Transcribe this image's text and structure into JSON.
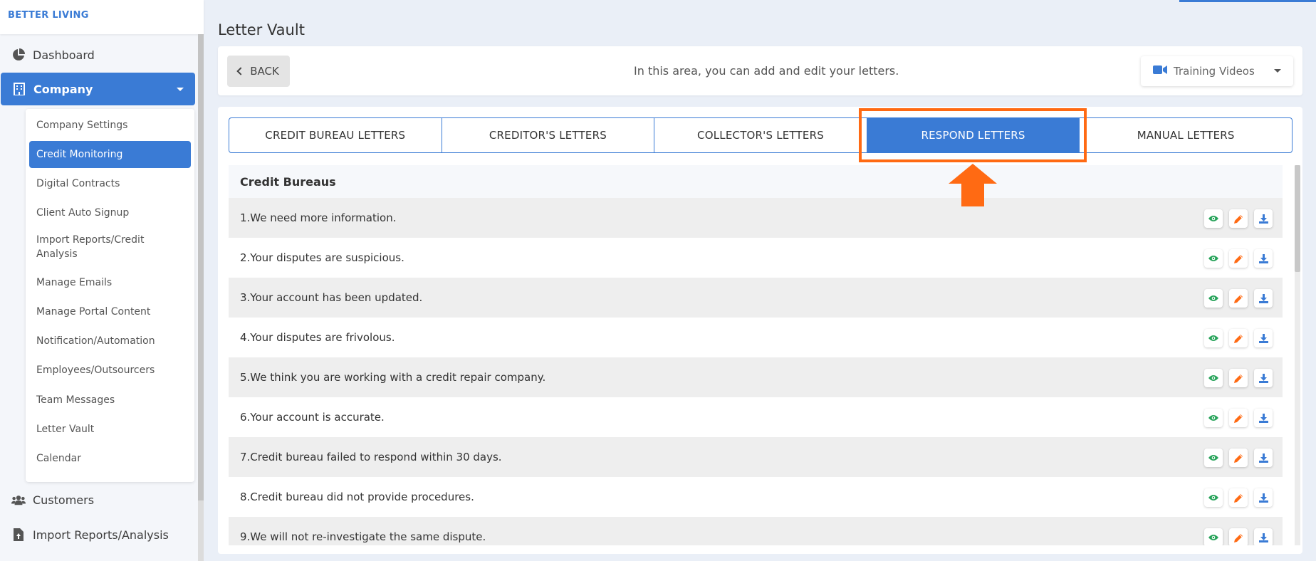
{
  "brand": "BETTER LIVING",
  "sidebar": {
    "items": [
      {
        "label": "Dashboard",
        "icon": "pie-chart-icon"
      },
      {
        "label": "Company",
        "icon": "building-icon",
        "active": true
      },
      {
        "label": "Customers",
        "icon": "users-icon"
      },
      {
        "label": "Import Reports/Analysis",
        "icon": "file-upload-icon"
      }
    ],
    "submenu": [
      "Company Settings",
      "Credit Monitoring",
      "Digital Contracts",
      "Client Auto Signup",
      "Import Reports/Credit Analysis",
      "Manage Emails",
      "Manage Portal Content",
      "Notification/Automation",
      "Employees/Outsourcers",
      "Team Messages",
      "Letter Vault",
      "Calendar"
    ],
    "submenu_active": "Credit Monitoring"
  },
  "page": {
    "title": "Letter Vault",
    "back_label": "BACK",
    "info": "In this area, you can add and edit your letters.",
    "training_videos": "Training Videos"
  },
  "tabs": [
    {
      "label": "CREDIT BUREAU LETTERS"
    },
    {
      "label": "CREDITOR'S LETTERS"
    },
    {
      "label": "COLLECTOR'S LETTERS"
    },
    {
      "label": "RESPOND LETTERS",
      "active": true
    },
    {
      "label": "MANUAL LETTERS"
    }
  ],
  "section_title": "Credit Bureaus",
  "letters": [
    "1.We need more information.",
    "2.Your disputes are suspicious.",
    "3.Your account has been updated.",
    "4.Your disputes are frivolous.",
    "5.We think you are working with a credit repair company.",
    "6.Your account is accurate.",
    "7.Credit bureau failed to respond within 30 days.",
    "8.Credit bureau did not provide procedures.",
    "9.We will not re-investigate the same dispute."
  ],
  "colors": {
    "accent": "#3a7bd5",
    "highlight": "#ff6a13",
    "view_icon": "#27a35a",
    "edit_icon": "#ff6a13",
    "download_icon": "#3a7bd5"
  }
}
